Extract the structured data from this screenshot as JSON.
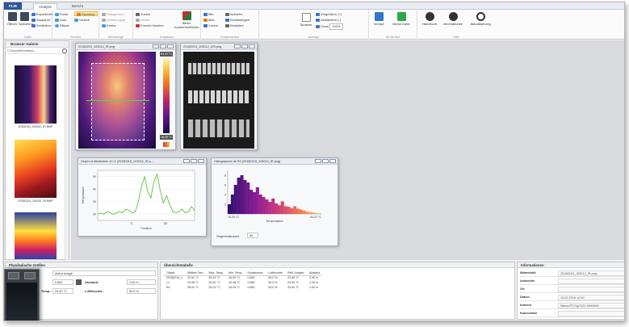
{
  "tabs": {
    "app": "FLIR",
    "items": [
      "Analyse",
      "Bericht"
    ]
  },
  "ribbon": {
    "datei": {
      "open": "Öffnen",
      "save": "Speichern",
      "export": "Exportieren",
      "snapshot": "Snapshot",
      "close": "Schließen",
      "label": "Datei"
    },
    "formen": {
      "punkt": "Punkt",
      "rechteck": "Rechteck",
      "linie": "Linie",
      "viereck": "Viereck",
      "ellipse": "Ellipse",
      "label": "Formen"
    },
    "werkzeuge": {
      "w1": "Histogramm",
      "w2": "Verteilungsgr.",
      "w3": "Kontur",
      "label": "Werkzeuge"
    },
    "bearbeiten": {
      "back": "Zurück",
      "vor": "Weiter",
      "clear": "Formen löschen",
      "combine": "Bilder zusammenführen",
      "label": "Anpassen"
    },
    "temperatur": {
      "min": "Min",
      "max": "Max",
      "cursor": "Cursor",
      "isotherm": "Isotherm",
      "settings": "Einstellungen",
      "units": "Einheiten",
      "label": "Temperaturen"
    },
    "anzeige": {
      "sprache": "Sprache",
      "zoom_in": "Vergrößern (+)",
      "zoom_out": "Verkleinern (-)",
      "zoom": "Zoom",
      "zoom_val": "100%",
      "label": "Anzeige"
    },
    "vl": {
      "verlauf": "Verlauf",
      "karte": "Meine Karte",
      "label": "IR-Verlauf"
    },
    "hilfe": {
      "handbuch": "Handbuch",
      "info": "Informationen",
      "update": "Aktualisierung",
      "label": "Hilfe"
    }
  },
  "browser": {
    "title": "Browser Galerie",
    "path": "C:\\Users\\flir\\Desktop\\...",
    "items": [
      "20150101_000110_IR.BMP",
      "20150103_204337_IR.BMP",
      ""
    ]
  },
  "windows": {
    "thermal_title": "20180215_103012_IR.png",
    "visual_title": "20180215_103012_VIS.png",
    "scale_max": "53.22 °C",
    "scale_min": "16.25 °C",
    "graph_title": "Graph of distribution of L1 (20180215_103012_IR.p...",
    "graph_ylabel": "Temperature",
    "graph_xlabel": "Position",
    "hist_title": "Histogramme de R2 (20180215_103012_IR.png)",
    "hist_xlabel": "Temperature",
    "hist_left": "16.25 °C",
    "hist_right": "53.22 °C",
    "seg_label": "Segmentanzahl:",
    "seg_value": "50"
  },
  "graph_data": {
    "yticks": [
      "50",
      "40",
      "30",
      "20"
    ],
    "xticks": [
      "0",
      "50"
    ],
    "values": [
      20,
      21,
      20,
      22,
      21,
      20,
      21,
      22,
      21,
      24,
      23,
      21,
      22,
      30,
      42,
      50,
      38,
      33,
      46,
      52,
      39,
      29,
      35,
      28,
      22,
      21,
      22,
      24,
      21,
      22,
      26,
      23
    ]
  },
  "hist_data": {
    "yticks": [
      "8",
      "6",
      "4",
      "2"
    ],
    "values": [
      2,
      4,
      6,
      7.5,
      8,
      7,
      6.5,
      5,
      4.5,
      5.5,
      4,
      3.5,
      3,
      2.5,
      3.2,
      2.2,
      1.8,
      2.6,
      1.6,
      1.5,
      1.2,
      1.6,
      1.1,
      0.9,
      0.7,
      0.5,
      0.4,
      0.3,
      0.2,
      0.15
    ]
  },
  "physical": {
    "title": "Physikalische Größen",
    "image_label": "Active image",
    "emiss": "0.650",
    "abstand_label": "Abstand:",
    "abstand": "2.00 m",
    "temp_label": "Temp.:",
    "temp": "23.00 °C",
    "luft_label": "Luftfeuchte:",
    "luft": "50.0 %"
  },
  "measurements": {
    "title": "Übersichtstabelle",
    "headers": [
      "Objekt",
      "Mittlere Tem.",
      "Max. Temp.",
      "Min. Temp.",
      "Emissionsw.",
      "Luftfeuchte",
      "Refl. Umgeb.",
      "Abstand"
    ],
    "rows": [
      [
        "20180215_1",
        "22.61 °C",
        "53.22 °C",
        "16.00 °C",
        "0.650",
        "50.0 %",
        "23.00 °C",
        "2.00 m"
      ],
      [
        "L1",
        "23.06 °C",
        "50.41 °C",
        "16.48 °C",
        "0.650",
        "50.0 %",
        "23.00 °C",
        "2.00 m"
      ],
      [
        "R2",
        "28.02 °C",
        "53.22 °C",
        "16.25 °C",
        "0.650",
        "50.0 %",
        "23.00 °C",
        "2.00 m"
      ]
    ]
  },
  "info": {
    "title": "Informationen",
    "rows": [
      {
        "k": "Wärmebild",
        "v": "20180215_103012_IR.png"
      },
      {
        "k": "Anwender",
        "v": ""
      },
      {
        "k": "Ort",
        "v": ""
      },
      {
        "k": "Datum",
        "v": "15.02.2018 10:30"
      },
      {
        "k": "Kamera",
        "v": "Marke/ST-Pg/2222-9999999"
      },
      {
        "k": "Kommentar",
        "v": ""
      }
    ]
  }
}
